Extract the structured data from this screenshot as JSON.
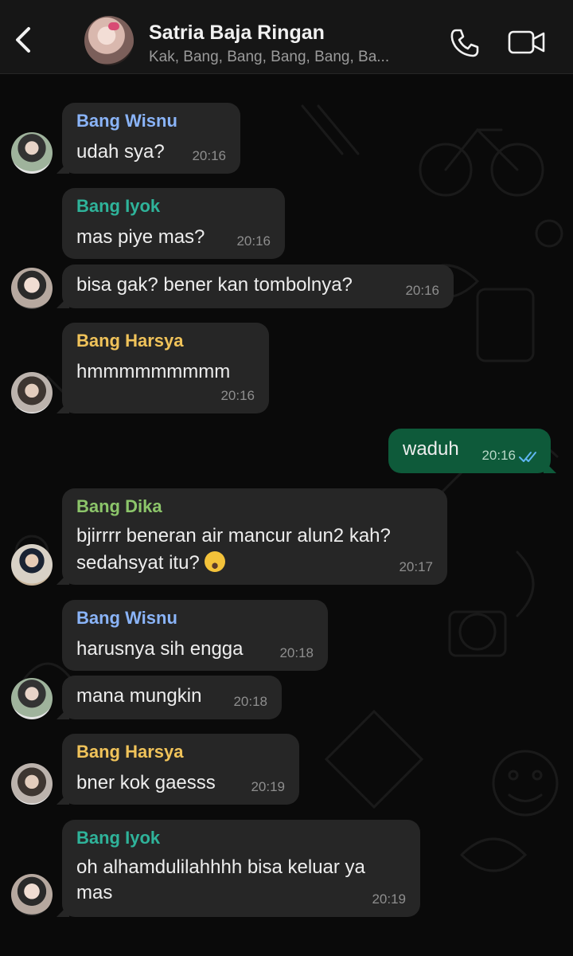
{
  "header": {
    "title": "Satria Baja Ringan",
    "subtitle": "Kak, Bang, Bang, Bang, Bang, Ba..."
  },
  "colors": {
    "wisnu": "#8ab4f8",
    "iyok": "#2fb39a",
    "harsya": "#f0c35a",
    "dika": "#8cc56a",
    "outgoing_bubble": "#0e5a3a",
    "incoming_bubble": "#262626"
  },
  "messages": [
    {
      "sender": "Bang Wisnu",
      "text": "udah sya?",
      "time": "20:16"
    },
    {
      "sender": "Bang Iyok",
      "text": "mas piye mas?",
      "time": "20:16"
    },
    {
      "text": "bisa gak? bener kan tombolnya?",
      "time": "20:16"
    },
    {
      "sender": "Bang Harsya",
      "text": "hmmmmmmmmm",
      "time": "20:16"
    },
    {
      "text": "waduh",
      "time": "20:16",
      "outgoing": true
    },
    {
      "sender": "Bang Dika",
      "text_line1": "bjirrrr beneran air mancur alun2 kah?",
      "text_line2": "sedahsyat itu?",
      "time": "20:17"
    },
    {
      "sender": "Bang Wisnu",
      "text": "harusnya sih engga",
      "time": "20:18"
    },
    {
      "text": "mana mungkin",
      "time": "20:18"
    },
    {
      "sender": "Bang Harsya",
      "text": "bner kok gaesss",
      "time": "20:19"
    },
    {
      "sender": "Bang Iyok",
      "text_line1": "oh alhamdulilahhhh bisa keluar ya",
      "text_line2": "mas",
      "time": "20:19"
    }
  ]
}
